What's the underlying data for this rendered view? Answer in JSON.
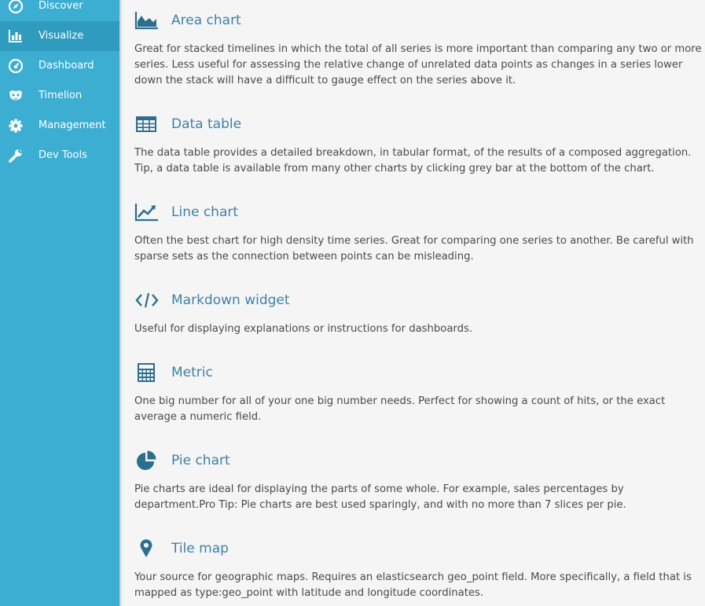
{
  "sidebar": {
    "items": [
      {
        "label": "Discover",
        "icon": "compass-icon"
      },
      {
        "label": "Visualize",
        "icon": "bar-chart-icon",
        "active": true
      },
      {
        "label": "Dashboard",
        "icon": "dashboard-gauge-icon"
      },
      {
        "label": "Timelion",
        "icon": "timelion-mask-icon"
      },
      {
        "label": "Management",
        "icon": "gear-icon"
      },
      {
        "label": "Dev Tools",
        "icon": "wrench-icon"
      }
    ]
  },
  "visualizations": [
    {
      "title": "Area chart",
      "icon": "area-chart-icon",
      "description": "Great for stacked timelines in which the total of all series is more important than comparing any two or more series. Less useful for assessing the relative change of unrelated data points as changes in a series lower down the stack will have a difficult to gauge effect on the series above it."
    },
    {
      "title": "Data table",
      "icon": "table-icon",
      "description": "The data table provides a detailed breakdown, in tabular format, of the results of a composed aggregation. Tip, a data table is available from many other charts by clicking grey bar at the bottom of the chart."
    },
    {
      "title": "Line chart",
      "icon": "line-chart-icon",
      "description": "Often the best chart for high density time series. Great for comparing one series to another. Be careful with sparse sets as the connection between points can be misleading."
    },
    {
      "title": "Markdown widget",
      "icon": "code-icon",
      "description": "Useful for displaying explanations or instructions for dashboards."
    },
    {
      "title": "Metric",
      "icon": "calculator-icon",
      "description": "One big number for all of your one big number needs. Perfect for showing a count of hits, or the exact average a numeric field."
    },
    {
      "title": "Pie chart",
      "icon": "pie-chart-icon",
      "description": "Pie charts are ideal for displaying the parts of some whole. For example, sales percentages by department.Pro Tip: Pie charts are best used sparingly, and with no more than 7 slices per pie."
    },
    {
      "title": "Tile map",
      "icon": "map-marker-icon",
      "description": "Your source for geographic maps. Requires an elasticsearch geo_point field. More specifically, a field that is mapped as type:geo_point with latitude and longitude coordinates."
    }
  ],
  "colors": {
    "sidebar": "#3caed2",
    "sidebar_active": "#2f9bbf",
    "title": "#3f81a6",
    "icon": "#2d6e8e",
    "text": "#4a4a4a",
    "background": "#f5f5f5"
  }
}
